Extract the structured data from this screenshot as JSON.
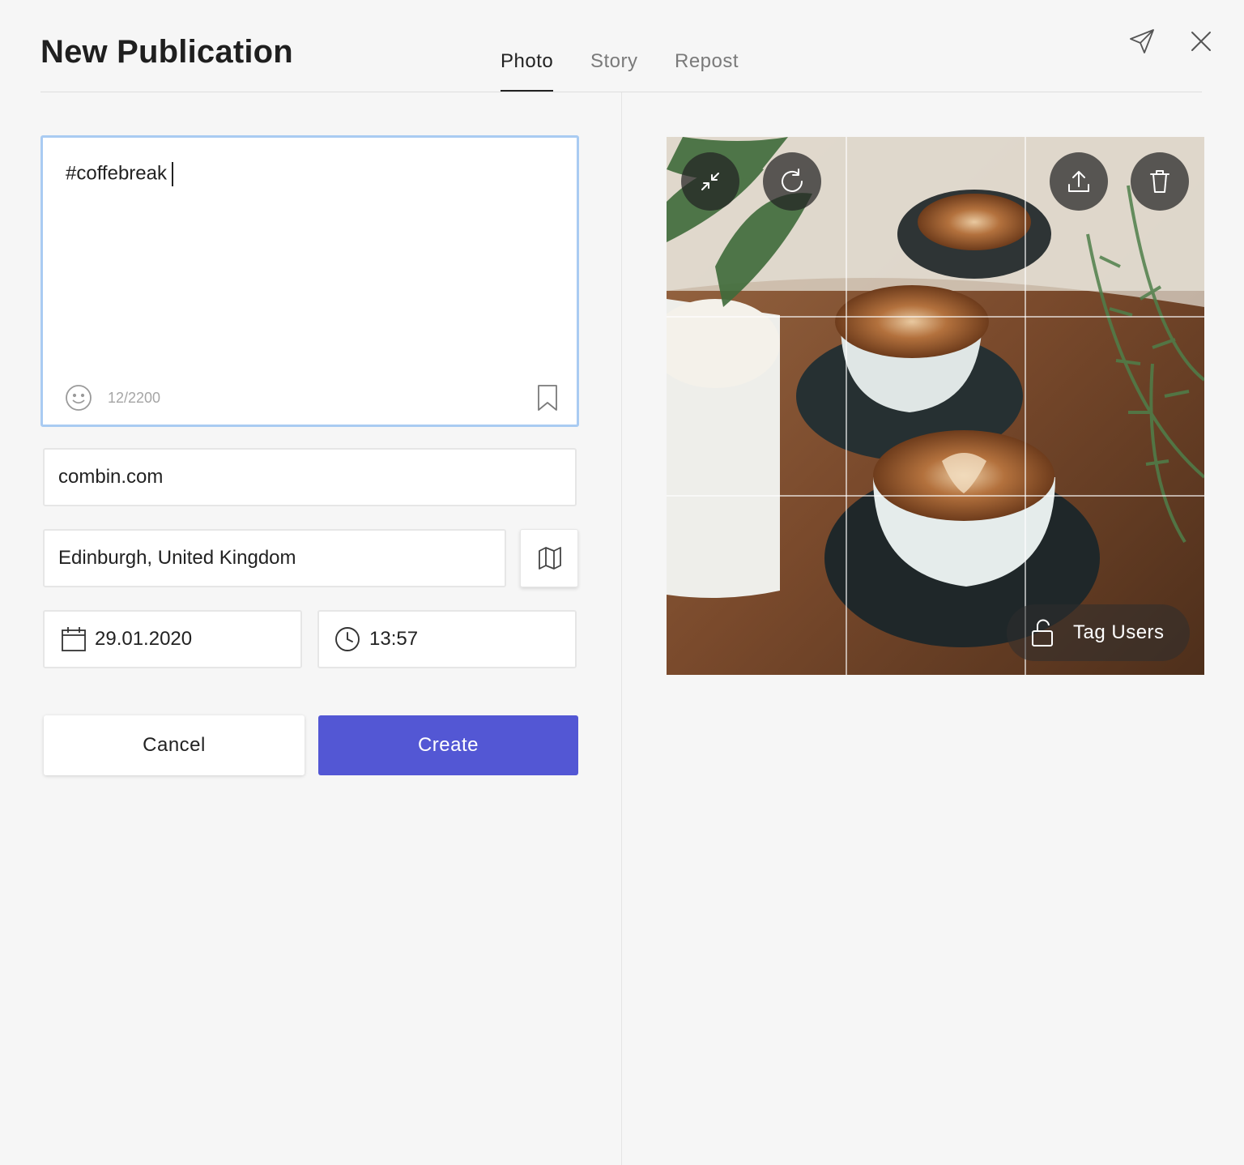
{
  "header": {
    "title": "New Publication",
    "tabs": [
      {
        "label": "Photo",
        "active": true
      },
      {
        "label": "Story",
        "active": false
      },
      {
        "label": "Repost",
        "active": false
      }
    ],
    "icons": [
      "send-icon",
      "close-icon"
    ]
  },
  "caption": {
    "text": "#coffebreak",
    "char_count": "12/2200"
  },
  "fields": {
    "website": "combin.com",
    "location": "Edinburgh, United Kingdom",
    "date": "29.01.2020",
    "time": "13:57"
  },
  "buttons": {
    "cancel": "Cancel",
    "create": "Create"
  },
  "photo": {
    "tag_users_label": "Tag Users",
    "tools": [
      "collapse-icon",
      "rotate-icon",
      "upload-icon",
      "trash-icon"
    ]
  },
  "colors": {
    "accent": "#5357d4",
    "focus_border": "#a9cbf2",
    "background": "#f6f6f6"
  }
}
